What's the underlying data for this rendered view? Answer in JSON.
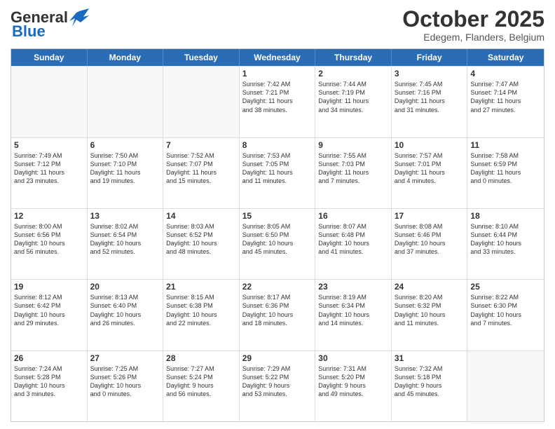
{
  "header": {
    "logo_general": "General",
    "logo_blue": "Blue",
    "month": "October 2025",
    "location": "Edegem, Flanders, Belgium"
  },
  "days_of_week": [
    "Sunday",
    "Monday",
    "Tuesday",
    "Wednesday",
    "Thursday",
    "Friday",
    "Saturday"
  ],
  "weeks": [
    [
      {
        "day": "",
        "info": "",
        "empty": true
      },
      {
        "day": "",
        "info": "",
        "empty": true
      },
      {
        "day": "",
        "info": "",
        "empty": true
      },
      {
        "day": "1",
        "info": "Sunrise: 7:42 AM\nSunset: 7:21 PM\nDaylight: 11 hours\nand 38 minutes.",
        "empty": false
      },
      {
        "day": "2",
        "info": "Sunrise: 7:44 AM\nSunset: 7:19 PM\nDaylight: 11 hours\nand 34 minutes.",
        "empty": false
      },
      {
        "day": "3",
        "info": "Sunrise: 7:45 AM\nSunset: 7:16 PM\nDaylight: 11 hours\nand 31 minutes.",
        "empty": false
      },
      {
        "day": "4",
        "info": "Sunrise: 7:47 AM\nSunset: 7:14 PM\nDaylight: 11 hours\nand 27 minutes.",
        "empty": false
      }
    ],
    [
      {
        "day": "5",
        "info": "Sunrise: 7:49 AM\nSunset: 7:12 PM\nDaylight: 11 hours\nand 23 minutes.",
        "empty": false
      },
      {
        "day": "6",
        "info": "Sunrise: 7:50 AM\nSunset: 7:10 PM\nDaylight: 11 hours\nand 19 minutes.",
        "empty": false
      },
      {
        "day": "7",
        "info": "Sunrise: 7:52 AM\nSunset: 7:07 PM\nDaylight: 11 hours\nand 15 minutes.",
        "empty": false
      },
      {
        "day": "8",
        "info": "Sunrise: 7:53 AM\nSunset: 7:05 PM\nDaylight: 11 hours\nand 11 minutes.",
        "empty": false
      },
      {
        "day": "9",
        "info": "Sunrise: 7:55 AM\nSunset: 7:03 PM\nDaylight: 11 hours\nand 7 minutes.",
        "empty": false
      },
      {
        "day": "10",
        "info": "Sunrise: 7:57 AM\nSunset: 7:01 PM\nDaylight: 11 hours\nand 4 minutes.",
        "empty": false
      },
      {
        "day": "11",
        "info": "Sunrise: 7:58 AM\nSunset: 6:59 PM\nDaylight: 11 hours\nand 0 minutes.",
        "empty": false
      }
    ],
    [
      {
        "day": "12",
        "info": "Sunrise: 8:00 AM\nSunset: 6:56 PM\nDaylight: 10 hours\nand 56 minutes.",
        "empty": false
      },
      {
        "day": "13",
        "info": "Sunrise: 8:02 AM\nSunset: 6:54 PM\nDaylight: 10 hours\nand 52 minutes.",
        "empty": false
      },
      {
        "day": "14",
        "info": "Sunrise: 8:03 AM\nSunset: 6:52 PM\nDaylight: 10 hours\nand 48 minutes.",
        "empty": false
      },
      {
        "day": "15",
        "info": "Sunrise: 8:05 AM\nSunset: 6:50 PM\nDaylight: 10 hours\nand 45 minutes.",
        "empty": false
      },
      {
        "day": "16",
        "info": "Sunrise: 8:07 AM\nSunset: 6:48 PM\nDaylight: 10 hours\nand 41 minutes.",
        "empty": false
      },
      {
        "day": "17",
        "info": "Sunrise: 8:08 AM\nSunset: 6:46 PM\nDaylight: 10 hours\nand 37 minutes.",
        "empty": false
      },
      {
        "day": "18",
        "info": "Sunrise: 8:10 AM\nSunset: 6:44 PM\nDaylight: 10 hours\nand 33 minutes.",
        "empty": false
      }
    ],
    [
      {
        "day": "19",
        "info": "Sunrise: 8:12 AM\nSunset: 6:42 PM\nDaylight: 10 hours\nand 29 minutes.",
        "empty": false
      },
      {
        "day": "20",
        "info": "Sunrise: 8:13 AM\nSunset: 6:40 PM\nDaylight: 10 hours\nand 26 minutes.",
        "empty": false
      },
      {
        "day": "21",
        "info": "Sunrise: 8:15 AM\nSunset: 6:38 PM\nDaylight: 10 hours\nand 22 minutes.",
        "empty": false
      },
      {
        "day": "22",
        "info": "Sunrise: 8:17 AM\nSunset: 6:36 PM\nDaylight: 10 hours\nand 18 minutes.",
        "empty": false
      },
      {
        "day": "23",
        "info": "Sunrise: 8:19 AM\nSunset: 6:34 PM\nDaylight: 10 hours\nand 14 minutes.",
        "empty": false
      },
      {
        "day": "24",
        "info": "Sunrise: 8:20 AM\nSunset: 6:32 PM\nDaylight: 10 hours\nand 11 minutes.",
        "empty": false
      },
      {
        "day": "25",
        "info": "Sunrise: 8:22 AM\nSunset: 6:30 PM\nDaylight: 10 hours\nand 7 minutes.",
        "empty": false
      }
    ],
    [
      {
        "day": "26",
        "info": "Sunrise: 7:24 AM\nSunset: 5:28 PM\nDaylight: 10 hours\nand 3 minutes.",
        "empty": false
      },
      {
        "day": "27",
        "info": "Sunrise: 7:25 AM\nSunset: 5:26 PM\nDaylight: 10 hours\nand 0 minutes.",
        "empty": false
      },
      {
        "day": "28",
        "info": "Sunrise: 7:27 AM\nSunset: 5:24 PM\nDaylight: 9 hours\nand 56 minutes.",
        "empty": false
      },
      {
        "day": "29",
        "info": "Sunrise: 7:29 AM\nSunset: 5:22 PM\nDaylight: 9 hours\nand 53 minutes.",
        "empty": false
      },
      {
        "day": "30",
        "info": "Sunrise: 7:31 AM\nSunset: 5:20 PM\nDaylight: 9 hours\nand 49 minutes.",
        "empty": false
      },
      {
        "day": "31",
        "info": "Sunrise: 7:32 AM\nSunset: 5:18 PM\nDaylight: 9 hours\nand 45 minutes.",
        "empty": false
      },
      {
        "day": "",
        "info": "",
        "empty": true
      }
    ]
  ]
}
